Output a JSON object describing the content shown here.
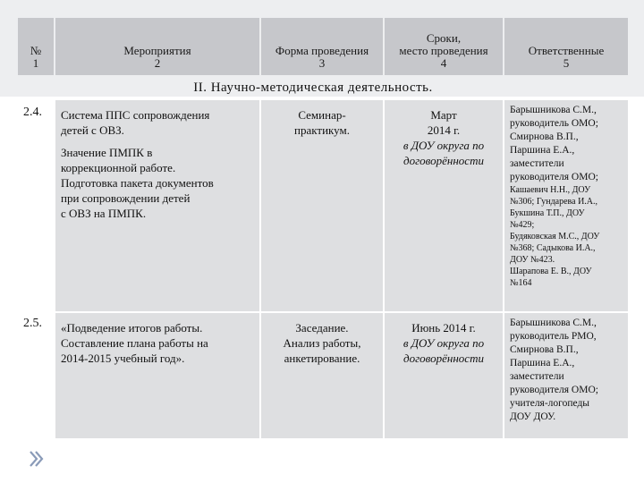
{
  "header": {
    "col1": {
      "title": "№",
      "num": "1"
    },
    "col2": {
      "title": "Мероприятия",
      "num": "2"
    },
    "col3": {
      "title": "Форма проведения",
      "num": "3"
    },
    "col4": {
      "title1": "Сроки,",
      "title2": "место проведения",
      "num": "4"
    },
    "col5": {
      "title": "Ответственные",
      "num": "5"
    }
  },
  "section_title": "II. Научно-методическая деятельность.",
  "rows": [
    {
      "num": "2.4.",
      "events": [
        "Система ППС сопровождения",
        "детей с ОВЗ."
      ],
      "events2": [
        "Значение ПМПК в",
        "коррекционной работе.",
        "Подготовка пакета документов",
        "при сопровождении детей",
        "с ОВЗ на ПМПК."
      ],
      "form": [
        "Семинар-",
        "практикум."
      ],
      "date": [
        "Март",
        "2014 г."
      ],
      "place": [
        "в ДОУ округа по",
        "договорённости"
      ],
      "responsible": [
        "Барышникова С.М.,",
        "руководитель ОМО;",
        "Смирнова В.П.,",
        "Паршина Е.А.,",
        "заместители",
        "руководителя ОМО;"
      ],
      "responsible_small": [
        "Кашаевич Н.Н., ДОУ",
        "№306; Гундарева И.А.,",
        "Букшина Т.П., ДОУ",
        "№429;",
        "Будяковская М.С., ДОУ",
        "№368; Садыкова И.А.,",
        "ДОУ №423.",
        " Шарапова Е. В., ДОУ",
        "№164"
      ]
    },
    {
      "num": "2.5.",
      "events": [
        "«Подведение итогов работы.",
        "Составление плана работы на",
        "2014-2015 учебный год»."
      ],
      "form": [
        "Заседание.",
        "Анализ работы,",
        "анкетирование."
      ],
      "date": [
        "Июнь 2014 г."
      ],
      "place": [
        "в ДОУ округа по",
        "договорённости"
      ],
      "responsible": [
        "Барышникова С.М.,",
        "руководитель РМО,",
        "Смирнова В.П.,",
        "Паршина Е.А.,",
        "заместители",
        "руководителя ОМО;",
        "учителя-логопеды",
        "ДОУ ДОУ."
      ]
    }
  ],
  "colors": {
    "band": "#edeef0",
    "header": "#c6c7cb",
    "cell": "#dedfe1",
    "arrow": "#8a9bb8"
  },
  "icons": {
    "nav": "double-chevron-right-icon"
  }
}
